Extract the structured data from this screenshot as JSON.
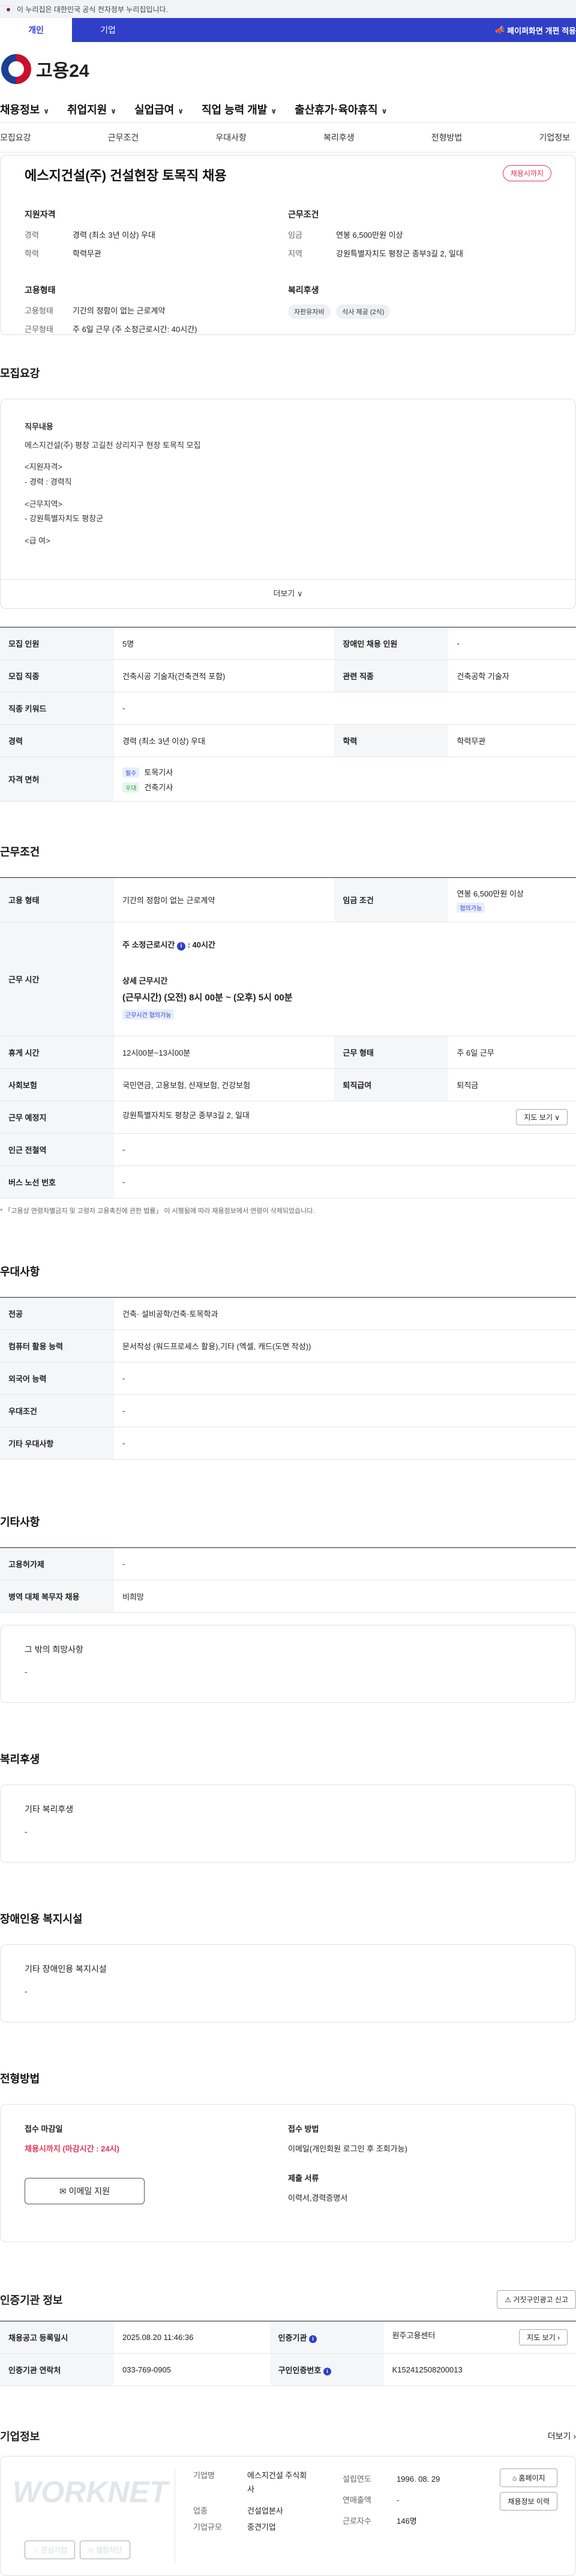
{
  "gov_bar": {
    "text": "이 누리집은 대한민국 공식 전자정부 누리집입니다."
  },
  "tabs": [
    {
      "label": "개인"
    },
    {
      "label": "기업"
    }
  ],
  "notice": {
    "label": "페이퍼화면 개편 적용"
  },
  "logo": {
    "text": "고용24"
  },
  "gnb": [
    {
      "label": "채용정보"
    },
    {
      "label": "취업지원"
    },
    {
      "label": "실업급여"
    },
    {
      "label": "직업 능력 개발"
    },
    {
      "label": "출산휴가·육아휴직"
    }
  ],
  "subnav": [
    "모집요강",
    "근무조건",
    "우대사항",
    "복리후생",
    "전형방법",
    "기업정보"
  ],
  "summary": {
    "title": "에스지건설(주) 건설현장 토목직 채용",
    "status": "채용시까지",
    "qual_title": "지원자격",
    "qual": [
      {
        "k": "경력",
        "v": "경력 (최소 3년 이상) 우대"
      },
      {
        "k": "학력",
        "v": "학력무관"
      }
    ],
    "cond_title": "근무조건",
    "cond": [
      {
        "k": "임금",
        "v": "연봉 6,500만원 이상"
      },
      {
        "k": "지역",
        "v": "강원특별자치도 평창군 종부3길 2, 일대"
      }
    ],
    "emp_title": "고용형태",
    "emp": [
      {
        "k": "고용형태",
        "v": "기간의 정함이 없는 근로계약"
      },
      {
        "k": "근무형태",
        "v": "주 6일 근무 (주 소정근로시간: 40시간)"
      }
    ],
    "welfare_title": "복리후생",
    "welfare_chips": [
      "자판유자비",
      "식사 제공 (2식)"
    ]
  },
  "recruit": {
    "section": "모집요강",
    "desc_title": "직무내용",
    "desc_lines": [
      "에스지건설(주) 평창 고길천 상리지구 현장 토목직 모집",
      "",
      "<지원자격>",
      "- 경력 : 경력직",
      "",
      "<근무지역>",
      "- 강원특별자치도 평창군",
      "",
      "<급 여>"
    ],
    "more": "더보기",
    "rows": [
      {
        "k1": "모집 인원",
        "v1": "5명",
        "k2": "장애인 채용 인원",
        "v2": "-"
      },
      {
        "k1": "모집 직종",
        "v1": "건축시공 기술자(건축견적 포함)",
        "k2": "관련 직종",
        "v2": "건축공학 기술자"
      },
      {
        "k1": "직종 키워드",
        "v1": "-"
      },
      {
        "k1": "경력",
        "v1": "경력 (최소 3년 이상) 우대",
        "k2": "학력",
        "v2": "학력무관"
      }
    ],
    "license_label": "자격 면허",
    "licenses": [
      {
        "tag": "필수",
        "name": "토목기사"
      },
      {
        "tag": "우대",
        "name": "건축기사"
      }
    ]
  },
  "work": {
    "section": "근무조건",
    "emp_type_k": "고용 형태",
    "emp_type_v": "기간의 정함이 없는 근로계약",
    "wage_k": "임금 조건",
    "wage_v": "연봉 6,500만원 이상",
    "wage_tag": "협의가능",
    "hours_k": "근무 시간",
    "hours_main": "주 소정근로시간",
    "hours_main_v": ": 40시간",
    "hours_detail_title": "상세 근무시간",
    "hours_detail": "(근무시간) (오전) 8시 00분 ~ (오후) 5시 00분",
    "hours_tag": "근무시간 협의가능",
    "rows": [
      {
        "k1": "휴게 시간",
        "v1": "12시00분~13시00분",
        "k2": "근무 형태",
        "v2": "주 6일 근무"
      },
      {
        "k1": "사회보험",
        "v1": "국민연금, 고용보험, 산재보험, 건강보험",
        "k2": "퇴직급여",
        "v2": "퇴직금"
      }
    ],
    "place_k": "근무 예정지",
    "place_v": "강원특별자치도 평창군 종부3길 2, 일대",
    "map_btn": "지도 보기",
    "station_k": "인근 전철역",
    "station_v": "-",
    "bus_k": "버스 노선 번호",
    "bus_v": "-",
    "note": "「고용상 연령차별금지 및 고령자 고용촉진에 관한 법률」 이 시행됨에 따라 채용정보에서 연령이 삭제되었습니다."
  },
  "pref": {
    "section": "우대사항",
    "rows": [
      {
        "k": "전공",
        "v": "건축· 설비공학/건축·토목학과"
      },
      {
        "k": "컴퓨터 활용 능력",
        "v": "문서작성 (워드프로세스 활용),기타 (엑셀, 캐드(도면 작성))"
      },
      {
        "k": "외국어 능력",
        "v": "-"
      },
      {
        "k": "우대조건",
        "v": "-"
      },
      {
        "k": "기타 우대사항",
        "v": "-"
      }
    ]
  },
  "etc": {
    "section": "기타사항",
    "rows": [
      {
        "k": "고용허가제",
        "v": "-"
      },
      {
        "k": "병역 대체 복무자 채용",
        "v": "비희망"
      }
    ],
    "other_title": "그 밖의 희망사항",
    "other_v": "-"
  },
  "welfare": {
    "section": "복리후생",
    "title": "기타 복리후생",
    "v": "-"
  },
  "disabled": {
    "section": "장애인용 복지시설",
    "title": "기타 장애인용 복지시설",
    "v": "-"
  },
  "selection": {
    "section": "전형방법",
    "deadline_k": "접수 마감일",
    "deadline_v": "채용시까지 (마감시간 : 24시)",
    "method_k": "접수 방법",
    "method_v": "이메일(개인회원 로그인 후 조회가능)",
    "docs_k": "제출 서류",
    "docs_v": "이력서,경력증명서",
    "apply_btn": "이메일 지원"
  },
  "cert": {
    "section": "인증기관 정보",
    "report_btn": "거짓구인광고 신고",
    "rows": [
      {
        "k1": "채용공고 등록일시",
        "v1": "2025.08.20 11:46:36",
        "k2": "인증기관",
        "v2": "원주고용센터",
        "btn": "지도 보기"
      },
      {
        "k1": "인증기관 연락처",
        "v1": "033-769-0905",
        "k2": "구인인증번호",
        "v2": "K152412508200013"
      }
    ]
  },
  "company": {
    "section": "기업정보",
    "more": "더보기",
    "logo": "WORKNET",
    "fav_btn": "관심기업",
    "block_btn": "열람차단",
    "rows": [
      {
        "k": "기업명",
        "v": "에스지건설 주식회사"
      },
      {
        "k": "업종",
        "v": "건설업본사"
      },
      {
        "k": "기업규모",
        "v": "중견기업"
      }
    ],
    "rows2": [
      {
        "k": "설립연도",
        "v": "1996. 08. 29"
      },
      {
        "k": "연매출액",
        "v": "-"
      },
      {
        "k": "근로자수",
        "v": "146명"
      }
    ],
    "home_btn": "홈페이지",
    "jobs_btn": "채용정보 이력"
  }
}
